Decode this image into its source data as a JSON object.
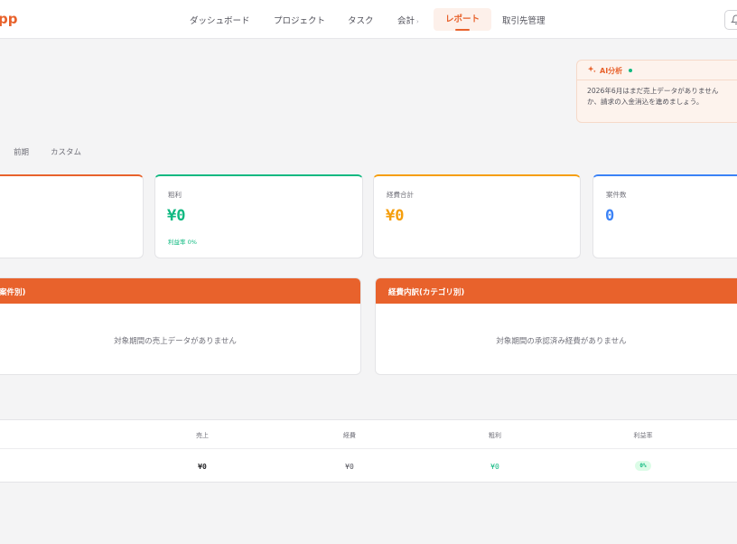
{
  "app": {
    "logo": "pp"
  },
  "nav": {
    "items": [
      {
        "label": "ダッシュボード"
      },
      {
        "label": "プロジェクト"
      },
      {
        "label": "タスク"
      },
      {
        "label": "会計",
        "caret": "›"
      },
      {
        "label": "レポート",
        "active": true
      },
      {
        "label": "取引先管理"
      }
    ]
  },
  "ai": {
    "title": "AI分析",
    "message": "2026年6月はまだ売上データがありません\nか、請求の入金消込を進めましょう。"
  },
  "period": {
    "tabs": [
      "前期",
      "カスタム"
    ]
  },
  "kpis": [
    {
      "label": "粗利",
      "value": "¥0",
      "sub": "利益率 0%",
      "color": "#10b981"
    },
    {
      "label": "経費合計",
      "value": "¥0",
      "color": "#f59e0b"
    },
    {
      "label": "案件数",
      "value": "0",
      "color": "#3b82f6"
    }
  ],
  "kpi_first_accent": "#e8622c",
  "panels": {
    "sales": {
      "title": "案件別)",
      "empty": "対象期間の売上データがありません"
    },
    "expenses": {
      "title": "経費内訳(カテゴリ別)",
      "empty": "対象期間の承認済み経費がありません"
    }
  },
  "table": {
    "headers": [
      "売上",
      "経費",
      "粗利",
      "利益率"
    ],
    "row": [
      "¥0",
      "¥0",
      "¥0",
      "0%"
    ]
  },
  "colors": {
    "brand": "#e8622c",
    "profit": "#10b981"
  }
}
